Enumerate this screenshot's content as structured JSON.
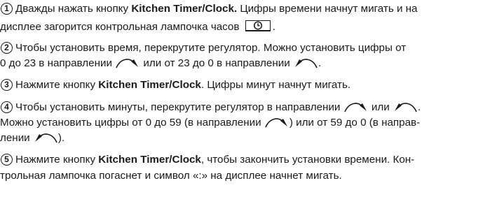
{
  "steps": [
    {
      "num": "1",
      "line1": {
        "a": "Дважды нажать кнопку ",
        "b": "Kitchen Timer/Clock.",
        "c": " Цифры времени начнут мигать и на"
      },
      "line2": {
        "a": "дисплее загорится контрольная лампочка часов"
      }
    },
    {
      "num": "2",
      "line1": {
        "a": "Чтобы установить время, перекрутите регулятор. Можно установить цифры от"
      },
      "line2": {
        "a": "0 до 23 в направлении",
        "b": "или от 23 до 0 в направлении",
        "c": "."
      }
    },
    {
      "num": "3",
      "line1": {
        "a": "Нажмите кнопку ",
        "b": "Kitchen Timer/Clock",
        "c": ". Цифры минут начнут мигать."
      }
    },
    {
      "num": "4",
      "line1": {
        "a": "Чтобы установить минуты, перекрутите регулятор в направлении",
        "b": "или",
        "c": "."
      },
      "line2": {
        "a": "Можно установить цифры от 0 до 59 (в направлении",
        "b": ") или от 59 до 0 (в направ-"
      },
      "line3": {
        "a": "лении",
        "b": ")."
      }
    },
    {
      "num": "5",
      "line1": {
        "a": "Нажмите кнопку ",
        "b": "Kitchen Timer/Clock",
        "c": ", чтобы закончить установки времени. Кон-"
      },
      "line2": {
        "a": "трольная лампочка погаснет и символ «:» на дисплее начнет мигать."
      }
    }
  ],
  "icons": {
    "clock": "clock-icon",
    "clockwise": "clockwise-arrow-icon",
    "counterclockwise": "counterclockwise-arrow-icon"
  }
}
